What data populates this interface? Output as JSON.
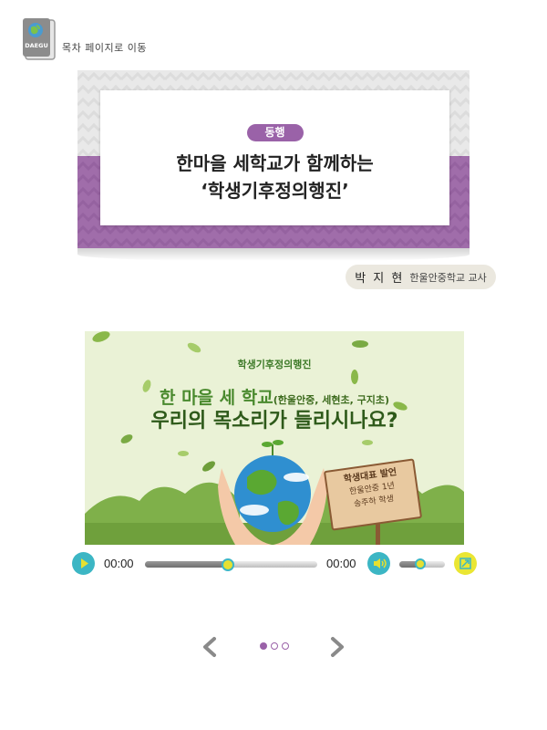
{
  "nav": {
    "toc_label": "목차 페이지로 이동",
    "logo_text": "DAEGU",
    "logo_icon": "book-globe-icon"
  },
  "article": {
    "category": "동행",
    "title_line1": "한마을 세학교가 함께하는",
    "title_line2": "‘학생기후정의행진’"
  },
  "author": {
    "name": "박 지 현",
    "role": "한울안중학교 교사"
  },
  "video": {
    "poster": {
      "subtitle": "학생기후정의행진",
      "title_main": "한 마을 세 학교",
      "title_schools": "(한울안중, 세현초, 구지초)",
      "title_line2": "우리의 목소리가 들리시나요?",
      "sign_title": "학생대표 발언",
      "sign_line1": "한울안중 1년",
      "sign_line2": "송주하 학생"
    },
    "current_time": "00:00",
    "duration": "00:00",
    "progress_fraction": 0.48,
    "volume_fraction": 0.45
  },
  "pager": {
    "total_pages": 3,
    "current_page": 1
  },
  "colors": {
    "accent_purple": "#9a62a8",
    "control_teal": "#3cb6c4",
    "control_yellow": "#eae633"
  }
}
